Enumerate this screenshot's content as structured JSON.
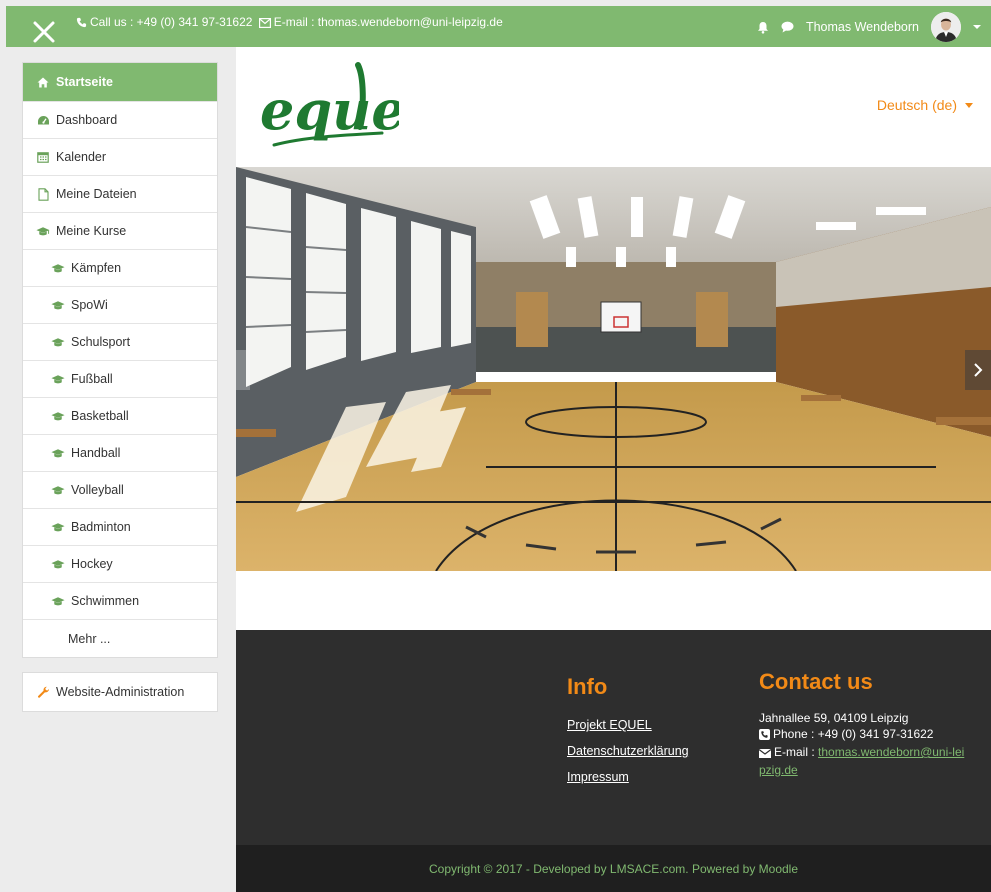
{
  "topbar": {
    "contact_text": "Call us : +49 (0) 341 97-31622",
    "email_text": "E-mail : thomas.wendeborn@uni-leipzig.de",
    "user_name": "Thomas Wendeborn"
  },
  "sidebar": {
    "items": [
      {
        "label": "Startseite",
        "icon": "home-icon"
      },
      {
        "label": "Dashboard",
        "icon": "dashboard-icon"
      },
      {
        "label": "Kalender",
        "icon": "calendar-icon"
      },
      {
        "label": "Meine Dateien",
        "icon": "file-icon"
      },
      {
        "label": "Meine Kurse",
        "icon": "graduation-cap-icon"
      }
    ],
    "courses": [
      "Kämpfen",
      "SpoWi",
      "Schulsport",
      "Fußball",
      "Basketball",
      "Handball",
      "Volleyball",
      "Badminton",
      "Hockey",
      "Schwimmen"
    ],
    "more_label": "Mehr ...",
    "admin_label": "Website-Administration"
  },
  "header": {
    "logo_text": "equel",
    "language": "Deutsch (de)"
  },
  "footer": {
    "info_title": "Info",
    "info_links": [
      "Projekt EQUEL",
      "Datenschutzerklärung",
      "Impressum"
    ],
    "contact_title": "Contact us",
    "address": "Jahnallee 59, 04109 Leipzig",
    "phone": "Phone : +49 (0) 341 97-31622",
    "email_label": "E-mail :",
    "email": "thomas.wendeborn@uni-leipzig.de",
    "copyright": "Copyright © 2017 - Developed by LMSACE.com. Powered by Moodle"
  },
  "colors": {
    "brand_green": "#80b970",
    "accent_orange": "#f28a17",
    "footer_dark": "#2e2e2e"
  }
}
